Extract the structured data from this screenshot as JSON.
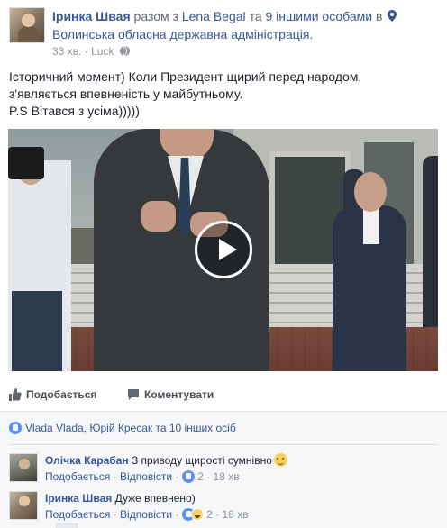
{
  "post": {
    "author": "Іринка Швая",
    "with_prefix": "разом з",
    "tagged_user": "Lena Begal",
    "and_text": "та",
    "others": "9 іншими особами",
    "in_text": "в",
    "location": "Волинська обласна державна адміністрація.",
    "time": "33 хв.",
    "separator": "·",
    "app": "Luck",
    "text_lines": [
      "Історичний момент) Коли Президент щирий перед народом,",
      "з'являється впевненість у майбутньому.",
      "P.S Вітався з усіма)))))"
    ]
  },
  "video": {
    "play_icon": "play-icon"
  },
  "actions": {
    "like_label": "Подобається",
    "comment_label": "Коментувати",
    "like_icon": "thumbs-up-icon",
    "comment_icon": "speech-bubble-icon"
  },
  "likes_summary": {
    "text": "Vlada Vlada, Юрій Кресак та 10 інших осіб"
  },
  "comments": [
    {
      "author": "Олічка Карабан",
      "text": "З приводу щирості сумнівно",
      "like_link": "Подобається",
      "reply_link": "Відповісти",
      "dot": "·",
      "reactions_count": "2",
      "time": "18 хв"
    },
    {
      "author": "Іринка Швая",
      "text": "Дуже впевнено)",
      "like_link": "Подобається",
      "reply_link": "Відповісти",
      "dot": "·",
      "reactions_count": "2",
      "time": "18 хв"
    }
  ],
  "colors": {
    "link": "#365899",
    "muted": "#90949c",
    "like_blue": "#5890ff",
    "comment_bg": "#f6f7f9"
  }
}
